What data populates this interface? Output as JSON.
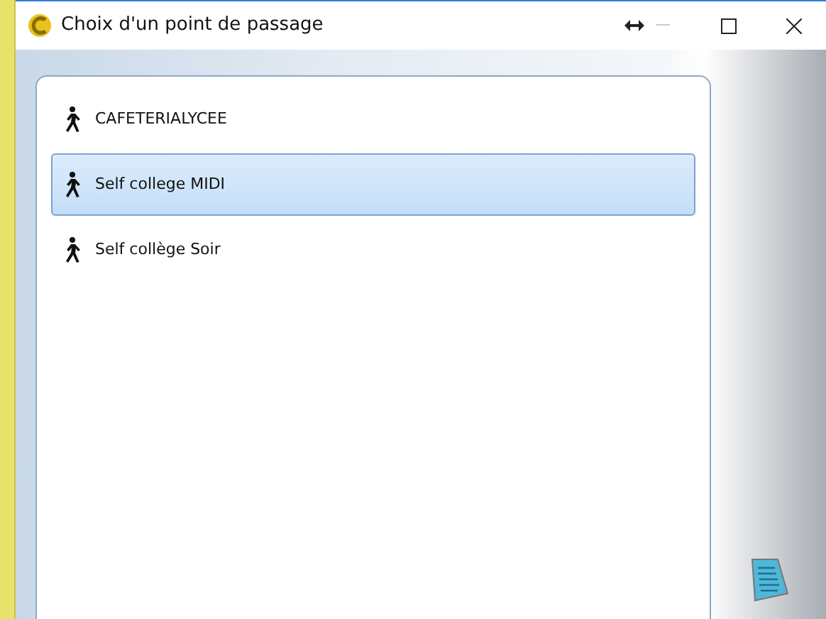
{
  "window": {
    "title": "Choix d'un point de passage"
  },
  "items": [
    {
      "label": "CAFETERIALYCEE",
      "selected": false
    },
    {
      "label": "Self college MIDI",
      "selected": true
    },
    {
      "label": "Self collège Soir",
      "selected": false
    }
  ]
}
